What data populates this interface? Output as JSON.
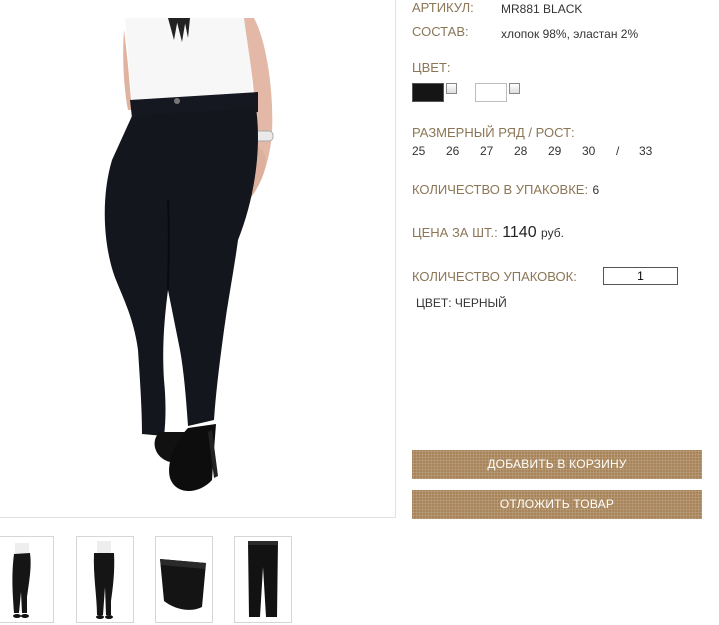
{
  "product": {
    "article_label": "АРТИКУЛ:",
    "article_value": "MR881 BLACK",
    "composition_label": "СОСТАВ:",
    "composition_value": "хлопок 98%, эластан 2%",
    "color_label": "ЦВЕТ:",
    "colors": [
      {
        "name": "black",
        "hex": "#151515"
      },
      {
        "name": "white",
        "hex": "#ffffff"
      }
    ],
    "size_label": "РАЗМЕРНЫЙ РЯД / РОСТ:",
    "sizes": [
      "25",
      "26",
      "27",
      "28",
      "29",
      "30",
      "/",
      "33"
    ],
    "pack_qty_label": "КОЛИЧЕСТВО В УПАКОВКЕ:",
    "pack_qty_value": "6",
    "price_label": "ЦЕНА ЗА ШТ.:",
    "price_value": "1140",
    "price_currency": "руб.",
    "packs_label": "КОЛИЧЕСТВО УПАКОВОК:",
    "packs_value": "1",
    "selected_color_text": "ЦВЕТ: ЧЕРНЫЙ"
  },
  "buttons": {
    "add_to_cart": "ДОБАВИТЬ В КОРЗИНУ",
    "postpone": "ОТЛОЖИТЬ ТОВАР"
  },
  "colors": {
    "label": "#8b7656",
    "button": "#a8855a"
  },
  "thumbnails": [
    {
      "name": "front view"
    },
    {
      "name": "back view"
    },
    {
      "name": "waistband detail"
    },
    {
      "name": "flat lay"
    }
  ]
}
